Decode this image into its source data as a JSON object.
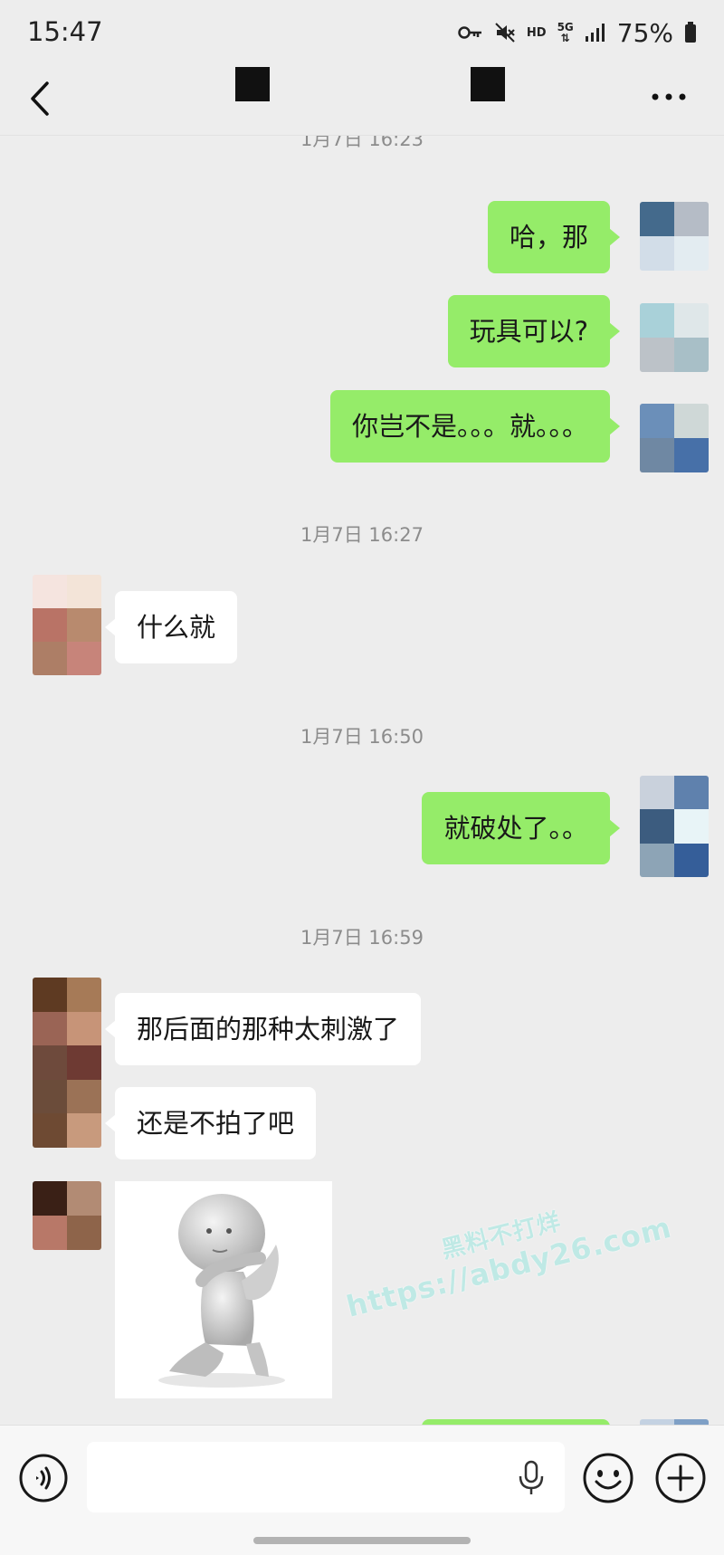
{
  "status_bar": {
    "time": "15:47",
    "hd_label": "HD",
    "network_label": "5G",
    "battery_percent": "75%",
    "icons": [
      "key-icon",
      "mute-icon",
      "signal-icon",
      "battery-icon"
    ]
  },
  "header": {
    "back_icon": "chevron-left-icon",
    "more_icon": "more-dots-icon"
  },
  "messages": {
    "ts0": "1月7日 16:23",
    "out1": "哈，那",
    "out2": "玩具可以?",
    "out3": "你岂不是。。。就。。。",
    "ts1": "1月7日 16:27",
    "in1": "什么就",
    "ts2": "1月7日 16:50",
    "out4": "就破处了。。",
    "ts3": "1月7日 16:59",
    "in2": "那后面的那种太刺激了",
    "in3": "还是不拍了吧",
    "sticker": "kneeling-figure-sticker"
  },
  "watermark": {
    "line1": "黑料不打烊",
    "line2": "https://abdy26.com"
  },
  "input_bar": {
    "value": "",
    "voice_icon": "voice-icon",
    "mic_icon": "microphone-icon",
    "emoji_icon": "emoji-icon",
    "plus_icon": "plus-icon"
  },
  "colors": {
    "background": "#ededed",
    "outgoing_bubble": "#95ec69",
    "incoming_bubble": "#ffffff",
    "timestamp": "#8c8c8c"
  }
}
